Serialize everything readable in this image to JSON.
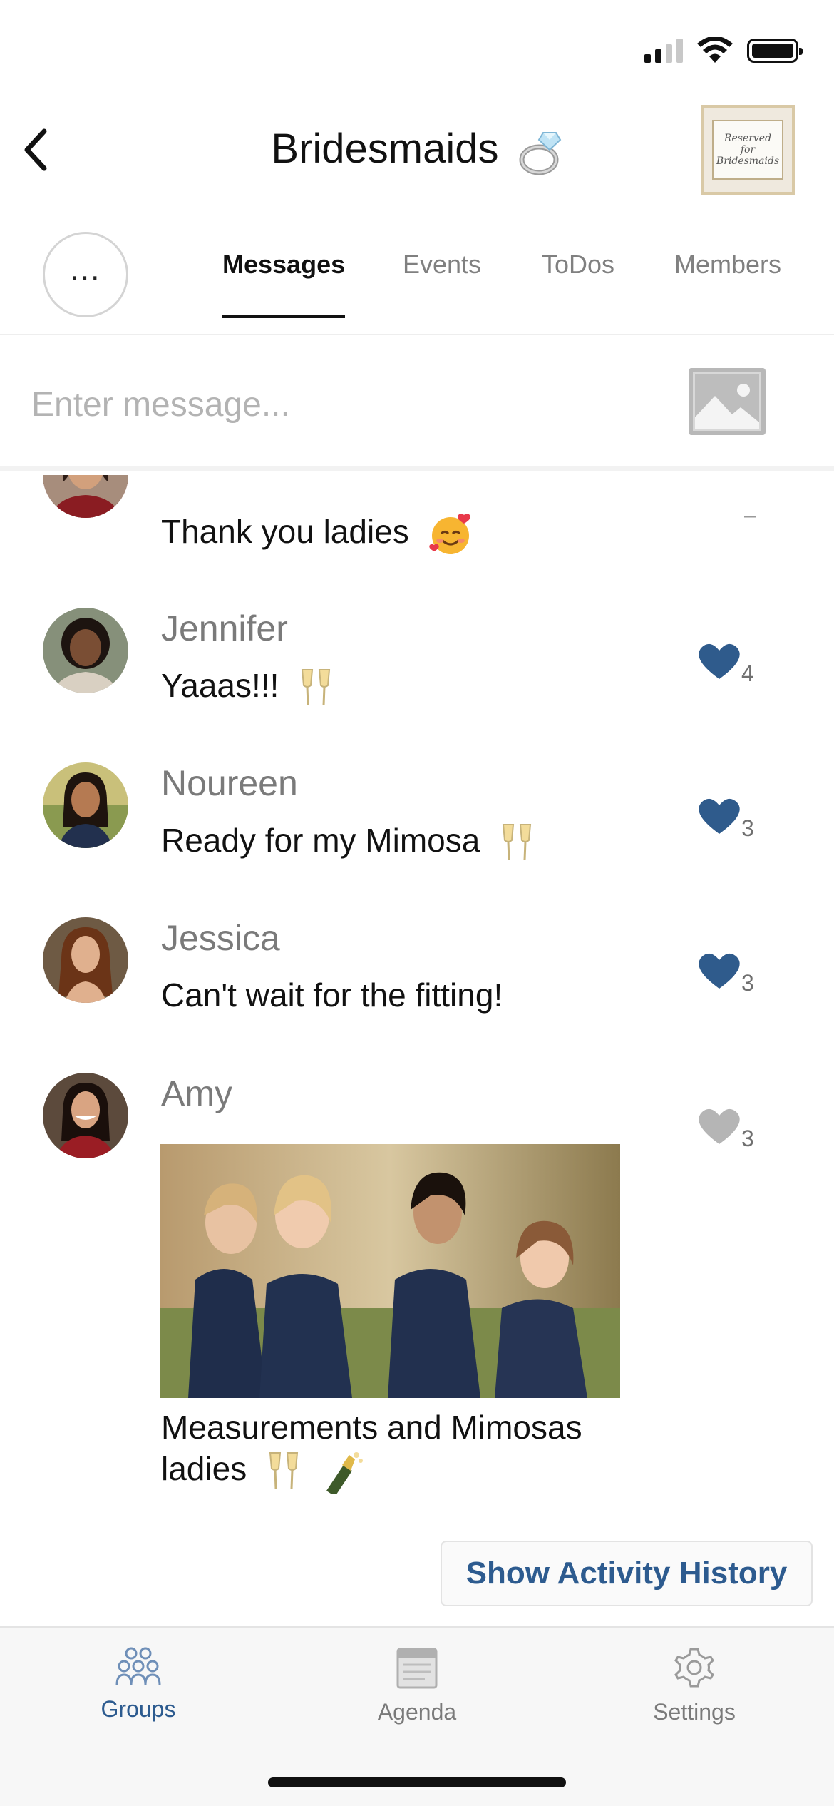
{
  "header": {
    "title": "Bridesmaids",
    "title_emoji": "ring",
    "back_icon": "chevron-left-icon",
    "group_image_text": "Reserved for Bridesmaids"
  },
  "tabs": {
    "more_label": "...",
    "items": [
      {
        "label": "Messages",
        "active": true
      },
      {
        "label": "Events",
        "active": false
      },
      {
        "label": "ToDos",
        "active": false
      },
      {
        "label": "Members",
        "active": false
      }
    ]
  },
  "compose": {
    "placeholder": "Enter message...",
    "image_icon": "image-icon"
  },
  "messages": [
    {
      "name": "",
      "text": "Thank you ladies",
      "emoji": "smiling-face-with-hearts",
      "likes": null
    },
    {
      "name": "Jennifer",
      "text": "Yaaas!!!",
      "emoji": "clinking-glasses",
      "likes": "4",
      "liked": true
    },
    {
      "name": "Noureen",
      "text": "Ready for my Mimosa",
      "emoji": "clinking-glasses",
      "likes": "3",
      "liked": true
    },
    {
      "name": "Jessica",
      "text": "Can't wait for the fitting!",
      "emoji": "",
      "likes": "3",
      "liked": true
    },
    {
      "name": "Amy",
      "text_line1": "Measurements and Mimosas",
      "text_line2": "ladies",
      "emoji": "clinking-glasses, champagne-bottle",
      "likes": "3",
      "liked": false,
      "has_photo": true
    }
  ],
  "activity_button": "Show Activity History",
  "nav": [
    {
      "label": "Groups",
      "icon": "groups-icon",
      "active": true
    },
    {
      "label": "Agenda",
      "icon": "agenda-icon",
      "active": false
    },
    {
      "label": "Settings",
      "icon": "settings-icon",
      "active": false
    }
  ],
  "colors": {
    "accent": "#2d5b8f",
    "heart_active": "#2f5b8c",
    "heart_inactive": "#b5b5b5"
  }
}
